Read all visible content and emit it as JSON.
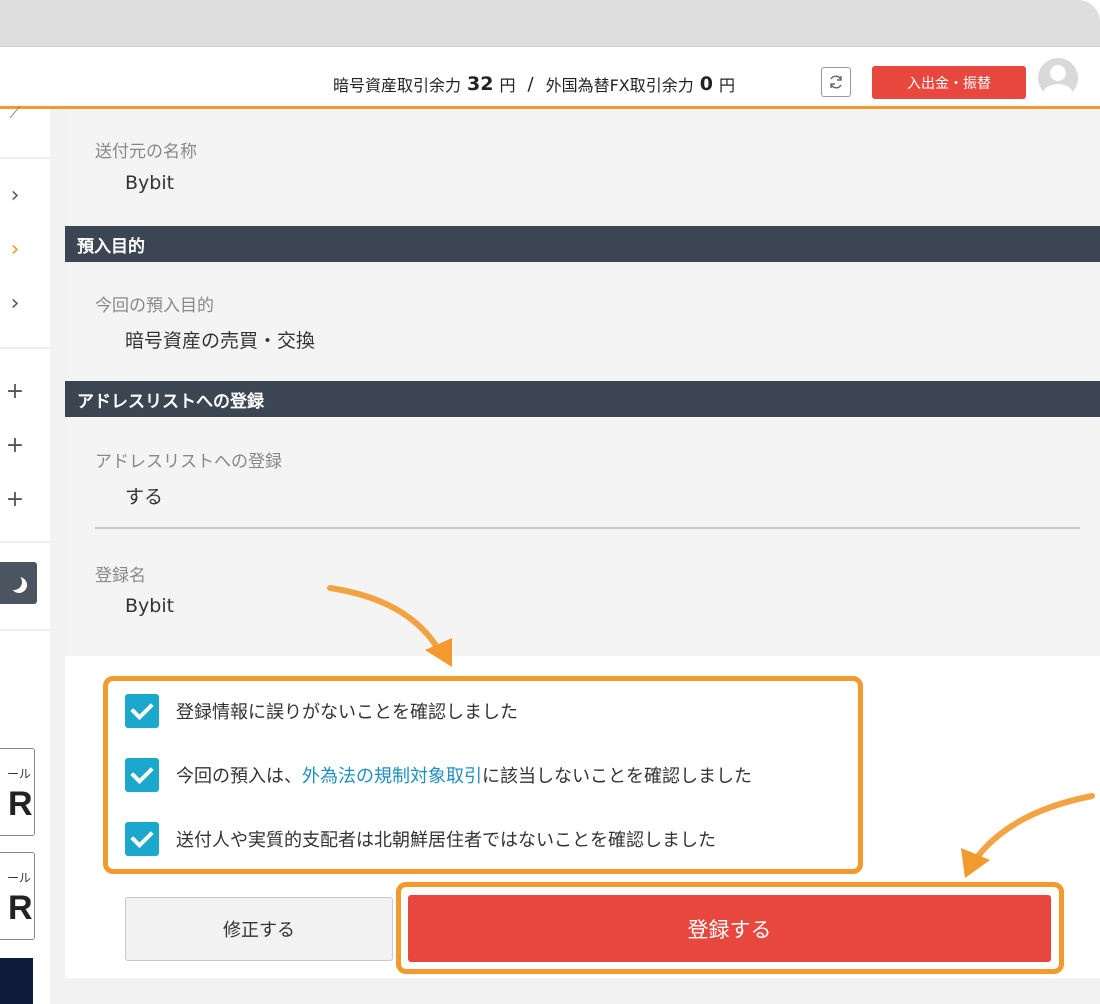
{
  "header": {
    "crypto_label": "暗号資産取引余力",
    "crypto_amount": "32",
    "crypto_unit": "円",
    "separator": "/",
    "fx_label": "外国為替FX取引余力",
    "fx_amount": "0",
    "fx_unit": "円",
    "deposit_button": "入出金・振替"
  },
  "sidebar": {
    "chevron": "›",
    "plus": "+",
    "ad_small": "ール",
    "ad_big": "R"
  },
  "sender": {
    "label": "送付元の名称",
    "value": "Bybit"
  },
  "purpose_section": {
    "title": "預入目的",
    "label": "今回の預入目的",
    "value": "暗号資産の売買・交換"
  },
  "address_section": {
    "title": "アドレスリストへの登録",
    "register_label": "アドレスリストへの登録",
    "register_value": "する",
    "name_label": "登録名",
    "name_value": "Bybit"
  },
  "confirmations": [
    {
      "text": "登録情報に誤りがないことを確認しました"
    },
    {
      "before": "今回の預入は、",
      "link": "外為法の規制対象取引",
      "after": "に該当しないことを確認しました"
    },
    {
      "text": "送付人や実質的支配者は北朝鮮居住者ではないことを確認しました"
    }
  ],
  "actions": {
    "edit": "修正する",
    "submit": "登録する"
  },
  "colors": {
    "accent_orange": "#f29a2e",
    "primary_red": "#e8473d",
    "section_dark": "#3c4652",
    "checkbox_blue": "#1aa9cc",
    "link_blue": "#1f8fc2"
  }
}
